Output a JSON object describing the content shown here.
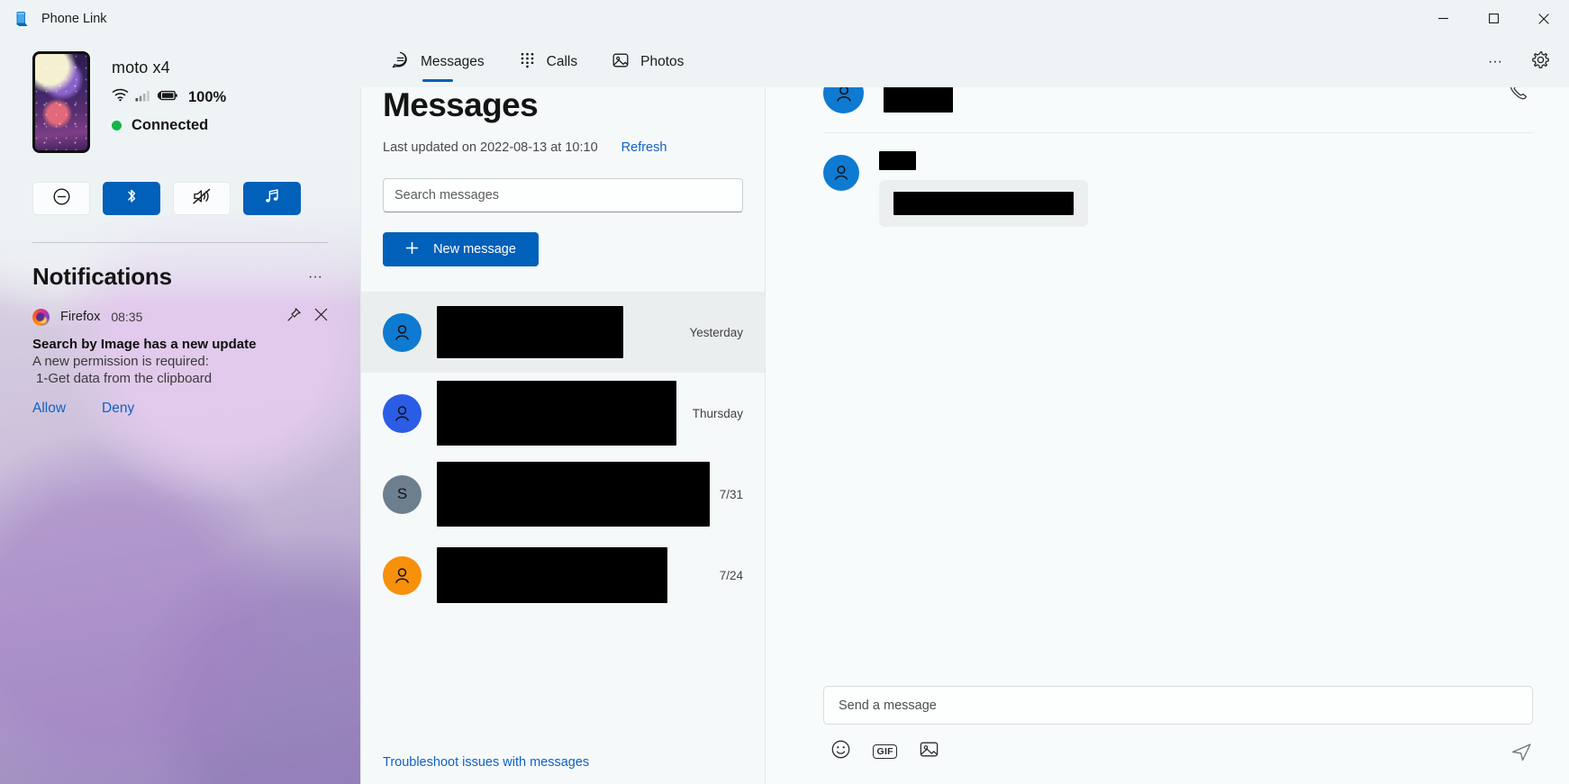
{
  "window": {
    "title": "Phone Link",
    "icon": "phone-link-icon",
    "controls": {
      "minimize": "–",
      "maximize": "☐",
      "close": "✕"
    }
  },
  "sidebar": {
    "device": {
      "name": "moto x4",
      "battery_percent": "100%",
      "status": "Connected",
      "status_color": "#17b546",
      "icons": [
        "wifi-icon",
        "cellular-signal-icon",
        "battery-charging-icon"
      ]
    },
    "quick_actions": [
      {
        "name": "do-not-disturb",
        "icon": "do-not-disturb-icon",
        "active": false
      },
      {
        "name": "bluetooth",
        "icon": "bluetooth-icon",
        "active": true
      },
      {
        "name": "volume-mute",
        "icon": "volume-mute-icon",
        "active": false
      },
      {
        "name": "music",
        "icon": "music-note-icon",
        "active": true
      }
    ],
    "notifications": {
      "title": "Notifications",
      "more_label": "···",
      "items": [
        {
          "app": "Firefox",
          "app_icon": "firefox-icon",
          "time": "08:35",
          "title": "Search by Image has a new update",
          "line1": "A new permission is required:",
          "line2": "1-Get data from the clipboard",
          "actions": [
            "Allow",
            "Deny"
          ],
          "pin_icon": "pin-icon",
          "close_icon": "close-icon"
        }
      ]
    }
  },
  "topnav": {
    "tabs": [
      {
        "label": "Messages",
        "icon": "message-bubble-icon",
        "active": true
      },
      {
        "label": "Calls",
        "icon": "dialpad-icon",
        "active": false
      },
      {
        "label": "Photos",
        "icon": "photo-icon",
        "active": false
      }
    ],
    "more_label": "···",
    "settings_icon": "gear-icon"
  },
  "messages": {
    "heading": "Messages",
    "last_updated": "Last updated on 2022-08-13 at 10:10",
    "refresh_label": "Refresh",
    "search": {
      "placeholder": "Search messages",
      "value": ""
    },
    "new_message_label": "New message",
    "new_message_icon": "plus-icon",
    "troubleshoot_label": "Troubleshoot issues with messages",
    "conversations": [
      {
        "avatar_type": "person",
        "avatar_color": "#0f7ad1",
        "avatar_letter": "",
        "name_redacted": true,
        "name_width": 207,
        "name_height": 58,
        "time": "Yesterday",
        "selected": true
      },
      {
        "avatar_type": "person",
        "avatar_color": "#2b5ce6",
        "avatar_letter": "",
        "name_redacted": true,
        "name_width": 266,
        "name_height": 72,
        "time": "Thursday",
        "selected": false
      },
      {
        "avatar_type": "letter",
        "avatar_color": "#6d7e8f",
        "avatar_letter": "S",
        "name_redacted": true,
        "name_width": 303,
        "name_height": 72,
        "time": "7/31",
        "selected": false
      },
      {
        "avatar_type": "person",
        "avatar_color": "#f7900b",
        "avatar_letter": "",
        "name_redacted": true,
        "name_width": 256,
        "name_height": 62,
        "time": "7/24",
        "selected": false
      }
    ]
  },
  "thread": {
    "header": {
      "avatar_color": "#0f7ad1",
      "name_redacted": true,
      "name_width": 77,
      "name_height": 42,
      "call_icon": "phone-call-icon"
    },
    "bubbles": [
      {
        "avatar_color": "#0f7ad1",
        "sender_redacted_width": 41,
        "sender_redacted_height": 21,
        "body_redacted_width": 200,
        "body_redacted_height": 26
      }
    ],
    "compose": {
      "placeholder": "Send a message",
      "value": "",
      "tools": [
        {
          "name": "emoji",
          "icon": "emoji-icon",
          "label": ""
        },
        {
          "name": "gif",
          "icon": "gif-icon",
          "label": "GIF"
        },
        {
          "name": "image",
          "icon": "image-icon",
          "label": ""
        }
      ],
      "send_icon": "send-icon"
    }
  },
  "colors": {
    "accent": "#0160b9",
    "link": "#1161c4",
    "connected": "#17b546",
    "selected_row": "#eaeeee"
  }
}
